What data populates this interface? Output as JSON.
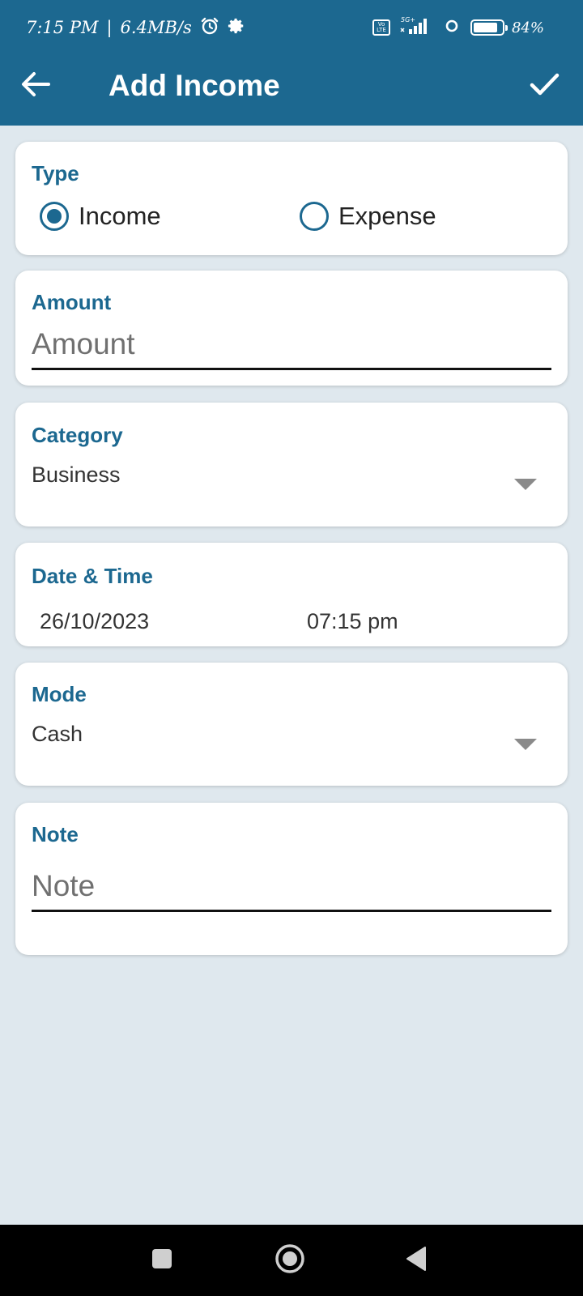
{
  "status_bar": {
    "time": "7:15 PM",
    "separator": "|",
    "speed": "6.4MB/s",
    "icons": [
      "alarm-icon",
      "settings-gear-icon",
      "volte-icon",
      "5g-signal-icon",
      "hotspot-icon",
      "battery-icon"
    ],
    "volte_label": "Vo LTE",
    "network_label": "5G+",
    "battery_percent": "84%",
    "battery_level": 0.84
  },
  "app_bar": {
    "title": "Add Income",
    "back_icon": "arrow-left-icon",
    "save_icon": "check-icon",
    "color": "#1c6890"
  },
  "form": {
    "type": {
      "label": "Type",
      "options": [
        {
          "label": "Income",
          "selected": true
        },
        {
          "label": "Expense",
          "selected": false
        }
      ]
    },
    "amount": {
      "label": "Amount",
      "placeholder": "Amount",
      "value": ""
    },
    "category": {
      "label": "Category",
      "value": "Business"
    },
    "datetime": {
      "label": "Date & Time",
      "date": "26/10/2023",
      "time": "07:15 pm"
    },
    "mode": {
      "label": "Mode",
      "value": "Cash"
    },
    "note": {
      "label": "Note",
      "placeholder": "Note",
      "value": ""
    }
  },
  "nav_bar": {
    "buttons": [
      "recents-square-icon",
      "home-circle-icon",
      "back-triangle-icon"
    ]
  }
}
